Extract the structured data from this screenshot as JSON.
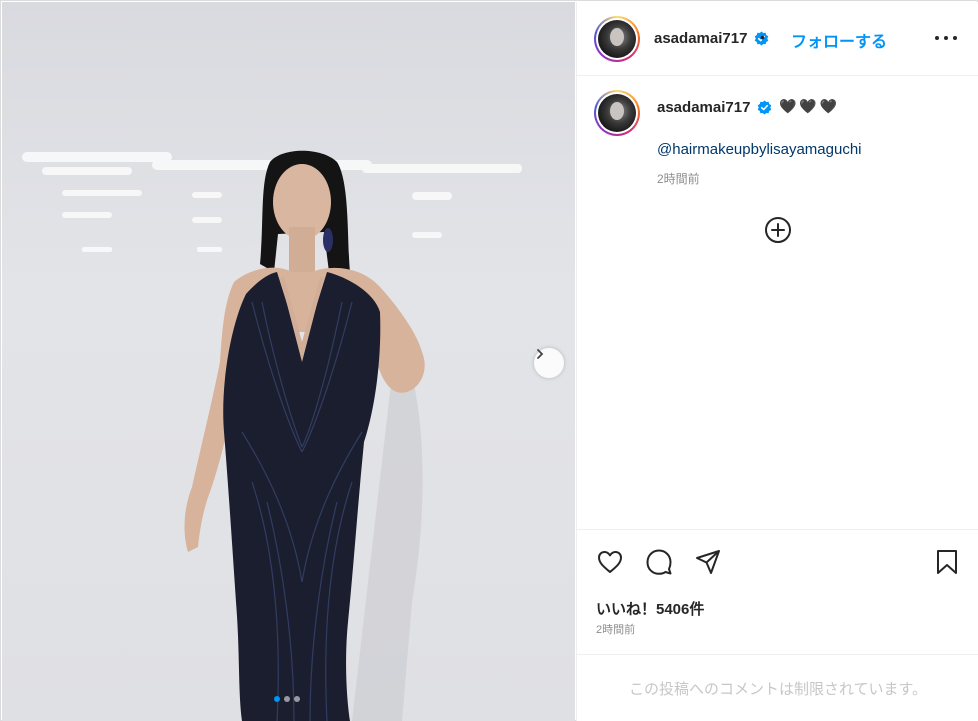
{
  "post": {
    "username": "asadamai717",
    "follow_label": "フォローする",
    "separator": "•",
    "caption_emoji": "🖤🖤🖤",
    "mention": "@hairmakeupbylisayamaguchi",
    "caption_time": "2時間前",
    "likes": "いいね！5406件",
    "post_time": "2時間前",
    "comments_limited": "この投稿へのコメントは制限されています。"
  },
  "carousel": {
    "slide_count": 3,
    "current_slide": 1
  },
  "colors": {
    "accent": "#0095f6",
    "mention": "#00376b",
    "muted": "#8e8e8e"
  },
  "icons": [
    "verified-icon",
    "more-options-icon",
    "add-icon",
    "heart-icon",
    "comment-icon",
    "share-icon",
    "save-icon",
    "chevron-right-icon"
  ]
}
